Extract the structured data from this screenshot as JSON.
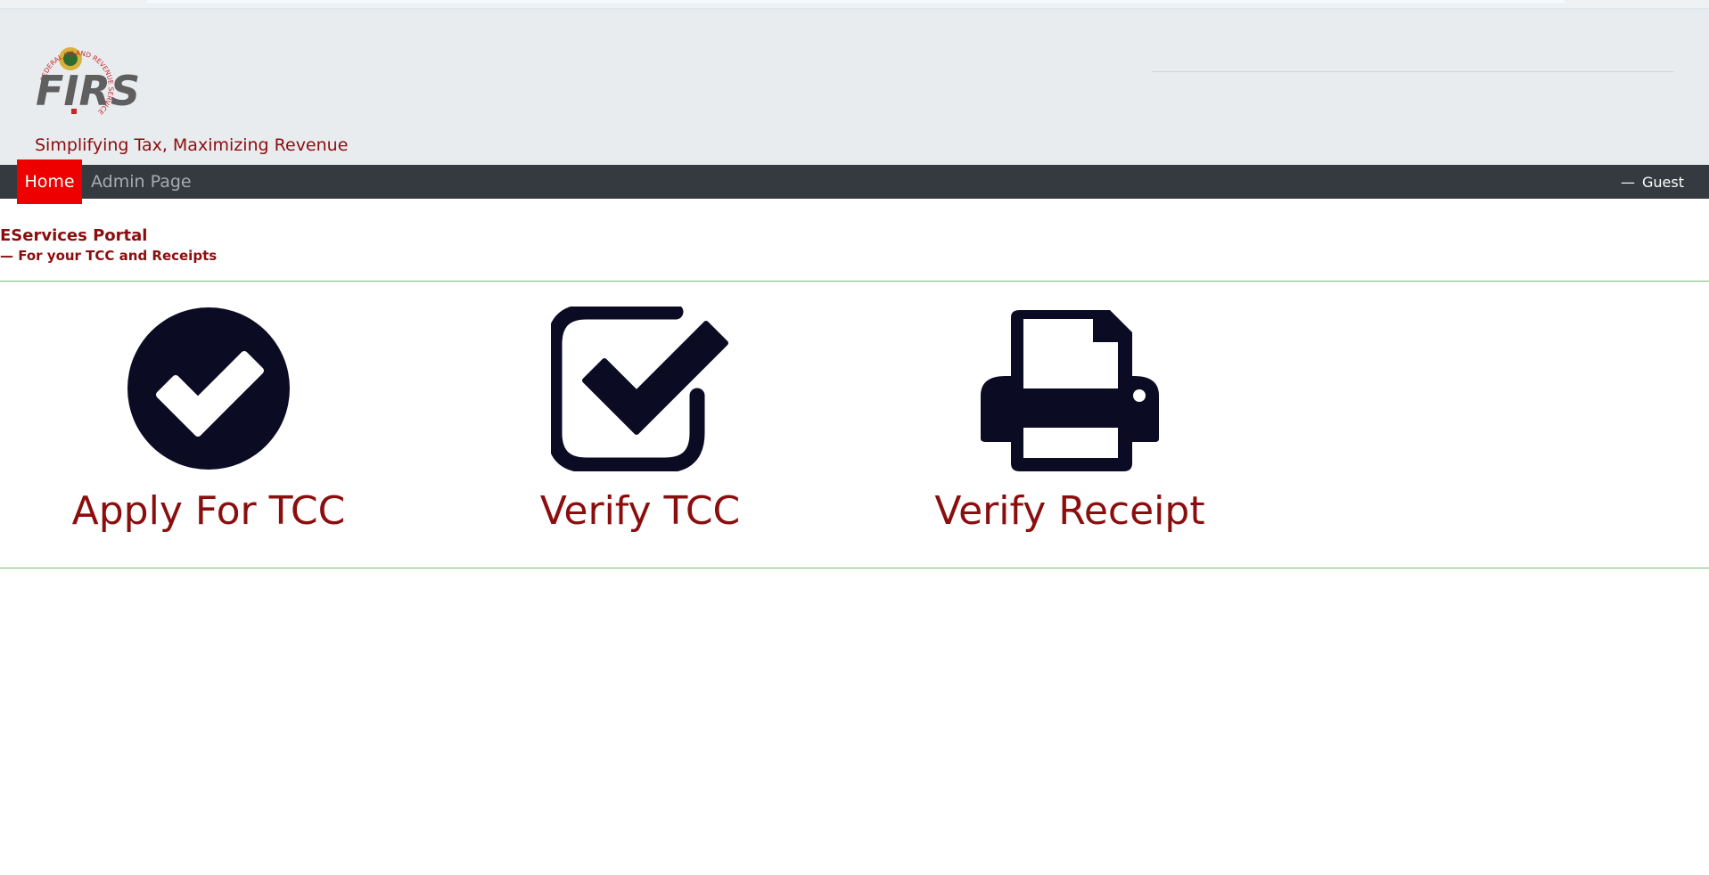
{
  "brand": {
    "logo_text": "FIRS",
    "logo_ring_text": "FEDERAL INLAND REVENUE SERVICE",
    "tagline": "Simplifying Tax, Maximizing Revenue"
  },
  "nav": {
    "items": [
      {
        "label": "Home",
        "active": true
      },
      {
        "label": "Admin Page",
        "active": false
      }
    ],
    "user_prefix": "—",
    "user_label": "Guest"
  },
  "portal": {
    "title": "EServices Portal",
    "subtitle": "— For your TCC and Receipts"
  },
  "cards": [
    {
      "label": "Apply For TCC",
      "icon": "check-circle-icon"
    },
    {
      "label": "Verify TCC",
      "icon": "check-square-icon"
    },
    {
      "label": "Verify Receipt",
      "icon": "print-icon"
    }
  ],
  "colors": {
    "brand_red": "#8b0e0e",
    "nav_active": "#ee0000",
    "navbar": "#343a40",
    "header_bg": "#e9ecef",
    "icon": "#0b0b24",
    "rule": "#6fc16f"
  }
}
